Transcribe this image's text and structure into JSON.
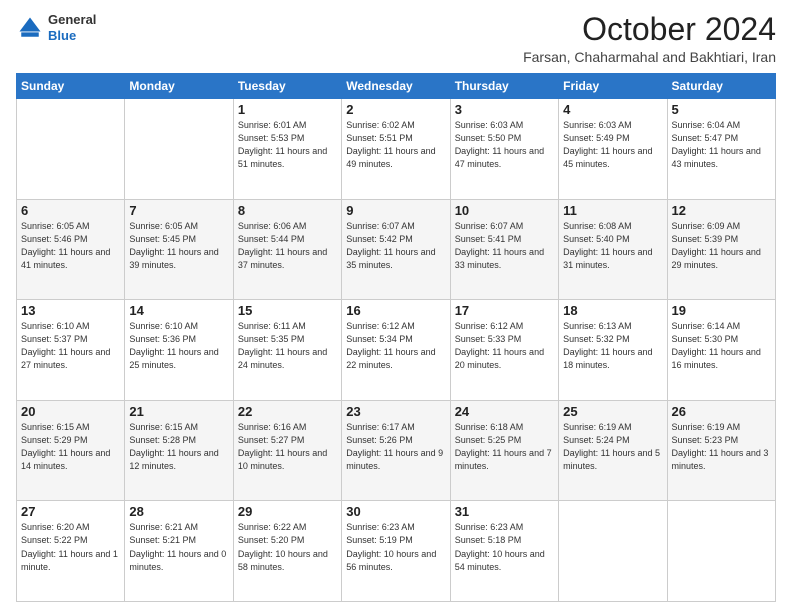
{
  "header": {
    "logo_general": "General",
    "logo_blue": "Blue",
    "month_title": "October 2024",
    "subtitle": "Farsan, Chaharmahal and Bakhtiari, Iran"
  },
  "weekdays": [
    "Sunday",
    "Monday",
    "Tuesday",
    "Wednesday",
    "Thursday",
    "Friday",
    "Saturday"
  ],
  "weeks": [
    [
      {
        "day": "",
        "info": ""
      },
      {
        "day": "",
        "info": ""
      },
      {
        "day": "1",
        "info": "Sunrise: 6:01 AM\nSunset: 5:53 PM\nDaylight: 11 hours and 51 minutes."
      },
      {
        "day": "2",
        "info": "Sunrise: 6:02 AM\nSunset: 5:51 PM\nDaylight: 11 hours and 49 minutes."
      },
      {
        "day": "3",
        "info": "Sunrise: 6:03 AM\nSunset: 5:50 PM\nDaylight: 11 hours and 47 minutes."
      },
      {
        "day": "4",
        "info": "Sunrise: 6:03 AM\nSunset: 5:49 PM\nDaylight: 11 hours and 45 minutes."
      },
      {
        "day": "5",
        "info": "Sunrise: 6:04 AM\nSunset: 5:47 PM\nDaylight: 11 hours and 43 minutes."
      }
    ],
    [
      {
        "day": "6",
        "info": "Sunrise: 6:05 AM\nSunset: 5:46 PM\nDaylight: 11 hours and 41 minutes."
      },
      {
        "day": "7",
        "info": "Sunrise: 6:05 AM\nSunset: 5:45 PM\nDaylight: 11 hours and 39 minutes."
      },
      {
        "day": "8",
        "info": "Sunrise: 6:06 AM\nSunset: 5:44 PM\nDaylight: 11 hours and 37 minutes."
      },
      {
        "day": "9",
        "info": "Sunrise: 6:07 AM\nSunset: 5:42 PM\nDaylight: 11 hours and 35 minutes."
      },
      {
        "day": "10",
        "info": "Sunrise: 6:07 AM\nSunset: 5:41 PM\nDaylight: 11 hours and 33 minutes."
      },
      {
        "day": "11",
        "info": "Sunrise: 6:08 AM\nSunset: 5:40 PM\nDaylight: 11 hours and 31 minutes."
      },
      {
        "day": "12",
        "info": "Sunrise: 6:09 AM\nSunset: 5:39 PM\nDaylight: 11 hours and 29 minutes."
      }
    ],
    [
      {
        "day": "13",
        "info": "Sunrise: 6:10 AM\nSunset: 5:37 PM\nDaylight: 11 hours and 27 minutes."
      },
      {
        "day": "14",
        "info": "Sunrise: 6:10 AM\nSunset: 5:36 PM\nDaylight: 11 hours and 25 minutes."
      },
      {
        "day": "15",
        "info": "Sunrise: 6:11 AM\nSunset: 5:35 PM\nDaylight: 11 hours and 24 minutes."
      },
      {
        "day": "16",
        "info": "Sunrise: 6:12 AM\nSunset: 5:34 PM\nDaylight: 11 hours and 22 minutes."
      },
      {
        "day": "17",
        "info": "Sunrise: 6:12 AM\nSunset: 5:33 PM\nDaylight: 11 hours and 20 minutes."
      },
      {
        "day": "18",
        "info": "Sunrise: 6:13 AM\nSunset: 5:32 PM\nDaylight: 11 hours and 18 minutes."
      },
      {
        "day": "19",
        "info": "Sunrise: 6:14 AM\nSunset: 5:30 PM\nDaylight: 11 hours and 16 minutes."
      }
    ],
    [
      {
        "day": "20",
        "info": "Sunrise: 6:15 AM\nSunset: 5:29 PM\nDaylight: 11 hours and 14 minutes."
      },
      {
        "day": "21",
        "info": "Sunrise: 6:15 AM\nSunset: 5:28 PM\nDaylight: 11 hours and 12 minutes."
      },
      {
        "day": "22",
        "info": "Sunrise: 6:16 AM\nSunset: 5:27 PM\nDaylight: 11 hours and 10 minutes."
      },
      {
        "day": "23",
        "info": "Sunrise: 6:17 AM\nSunset: 5:26 PM\nDaylight: 11 hours and 9 minutes."
      },
      {
        "day": "24",
        "info": "Sunrise: 6:18 AM\nSunset: 5:25 PM\nDaylight: 11 hours and 7 minutes."
      },
      {
        "day": "25",
        "info": "Sunrise: 6:19 AM\nSunset: 5:24 PM\nDaylight: 11 hours and 5 minutes."
      },
      {
        "day": "26",
        "info": "Sunrise: 6:19 AM\nSunset: 5:23 PM\nDaylight: 11 hours and 3 minutes."
      }
    ],
    [
      {
        "day": "27",
        "info": "Sunrise: 6:20 AM\nSunset: 5:22 PM\nDaylight: 11 hours and 1 minute."
      },
      {
        "day": "28",
        "info": "Sunrise: 6:21 AM\nSunset: 5:21 PM\nDaylight: 11 hours and 0 minutes."
      },
      {
        "day": "29",
        "info": "Sunrise: 6:22 AM\nSunset: 5:20 PM\nDaylight: 10 hours and 58 minutes."
      },
      {
        "day": "30",
        "info": "Sunrise: 6:23 AM\nSunset: 5:19 PM\nDaylight: 10 hours and 56 minutes."
      },
      {
        "day": "31",
        "info": "Sunrise: 6:23 AM\nSunset: 5:18 PM\nDaylight: 10 hours and 54 minutes."
      },
      {
        "day": "",
        "info": ""
      },
      {
        "day": "",
        "info": ""
      }
    ]
  ]
}
